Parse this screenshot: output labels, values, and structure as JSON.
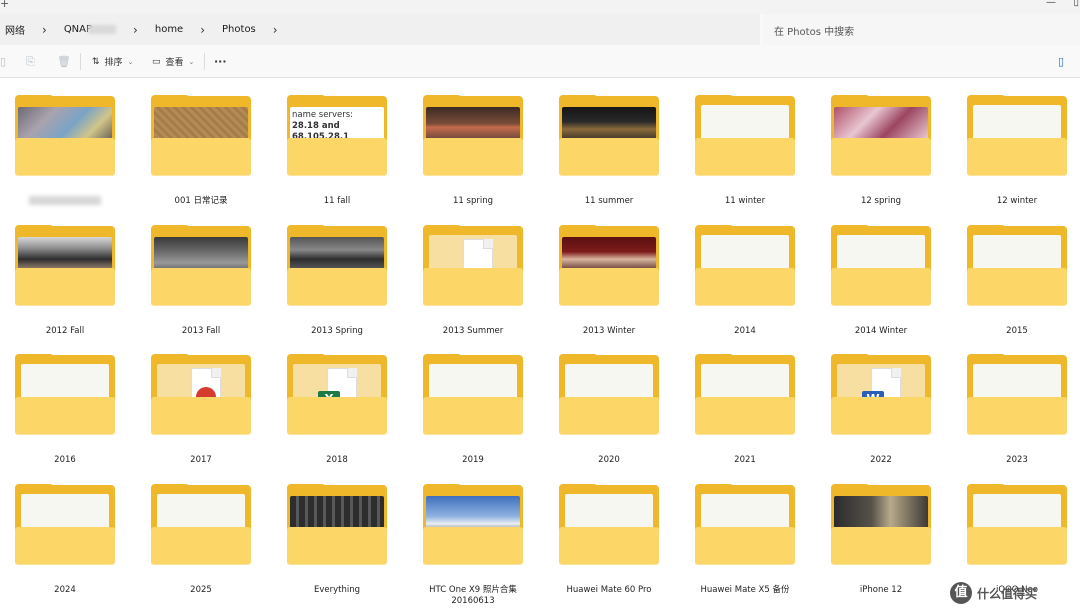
{
  "breadcrumb": [
    "网络",
    "QNAP",
    "home",
    "Photos"
  ],
  "search": {
    "placeholder": "在 Photos 中搜索"
  },
  "toolbar": {
    "sort_label": "排序",
    "view_label": "查看",
    "more_label": "···"
  },
  "folders": [
    {
      "name": "",
      "thumb": "photo-1"
    },
    {
      "name": "001 日常记录",
      "thumb": "photo-2"
    },
    {
      "name": "11 fall",
      "thumb": "text-dns"
    },
    {
      "name": "11 spring",
      "thumb": "photo-3"
    },
    {
      "name": "11 summer",
      "thumb": "photo-4"
    },
    {
      "name": "11 winter",
      "thumb": "empty"
    },
    {
      "name": "12 spring",
      "thumb": "photo-5"
    },
    {
      "name": "12 winter",
      "thumb": "empty"
    },
    {
      "name": "2012 Fall",
      "thumb": "photo-6"
    },
    {
      "name": "2013 Fall",
      "thumb": "photo-7"
    },
    {
      "name": "2013 Spring",
      "thumb": "photo-8"
    },
    {
      "name": "2013 Summer",
      "thumb": "doc"
    },
    {
      "name": "2013 Winter",
      "thumb": "photo-9"
    },
    {
      "name": "2014",
      "thumb": "empty"
    },
    {
      "name": "2014 Winter",
      "thumb": "empty"
    },
    {
      "name": "2015",
      "thumb": "empty"
    },
    {
      "name": "2016",
      "thumb": "empty"
    },
    {
      "name": "2017",
      "thumb": "pdf"
    },
    {
      "name": "2018",
      "thumb": "excel"
    },
    {
      "name": "2019",
      "thumb": "empty"
    },
    {
      "name": "2020",
      "thumb": "empty"
    },
    {
      "name": "2021",
      "thumb": "empty"
    },
    {
      "name": "2022",
      "thumb": "word"
    },
    {
      "name": "2023",
      "thumb": "empty"
    },
    {
      "name": "2024",
      "thumb": "empty"
    },
    {
      "name": "2025",
      "thumb": "empty"
    },
    {
      "name": "Everything",
      "thumb": "photo-10"
    },
    {
      "name": "HTC One X9 照片合集 20160613",
      "thumb": "photo-11"
    },
    {
      "name": "Huawei Mate 60 Pro",
      "thumb": "empty"
    },
    {
      "name": "Huawei Mate X5 备份",
      "thumb": "empty"
    },
    {
      "name": "iPhone 12",
      "thumb": "photo-12"
    },
    {
      "name": "iQOO Neo",
      "thumb": "empty"
    }
  ],
  "dns_thumb_text": [
    "name servers:",
    "28.18 and 68.105.28.1"
  ],
  "watermark": {
    "logo": "值",
    "text": "什么值得买"
  },
  "colors": {
    "folder_back": "#efb82b",
    "folder_front": "#fcd667",
    "excel": "#1d7a45",
    "word": "#2b5eb8",
    "pdf": "#d63b2f"
  }
}
